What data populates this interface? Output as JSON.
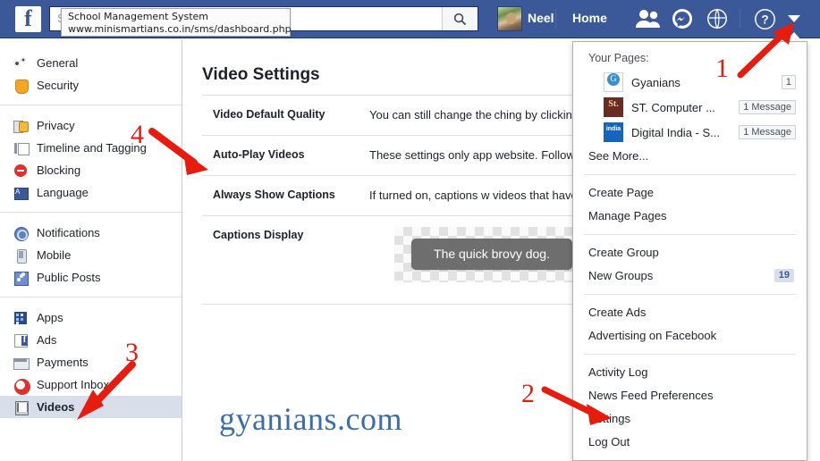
{
  "topbar": {
    "logo_text": "f",
    "search_placeholder": "Search",
    "search_icon": "search-icon",
    "profile_name": "Neel",
    "home_label": "Home",
    "icons": [
      "friend-requests-icon",
      "messenger-icon",
      "notifications-globe-icon",
      "help-icon",
      "account-caret-icon"
    ],
    "background_color": "#3b5998"
  },
  "tooltip": {
    "title": "School Management System",
    "url": "www.minismartians.co.in/sms/dashboard.php"
  },
  "sidebar": {
    "groups": [
      {
        "items": [
          {
            "label": "General",
            "icon": "gears-icon",
            "active": false
          },
          {
            "label": "Security",
            "icon": "shield-icon",
            "active": false
          }
        ]
      },
      {
        "items": [
          {
            "label": "Privacy",
            "icon": "lock-icon",
            "active": false
          },
          {
            "label": "Timeline and Tagging",
            "icon": "timeline-icon",
            "active": false
          },
          {
            "label": "Blocking",
            "icon": "block-icon",
            "active": false
          },
          {
            "label": "Language",
            "icon": "language-icon",
            "active": false
          }
        ]
      },
      {
        "items": [
          {
            "label": "Notifications",
            "icon": "globe-icon",
            "active": false
          },
          {
            "label": "Mobile",
            "icon": "mobile-icon",
            "active": false
          },
          {
            "label": "Public Posts",
            "icon": "rss-icon",
            "active": false
          }
        ]
      },
      {
        "items": [
          {
            "label": "Apps",
            "icon": "apps-icon",
            "active": false
          },
          {
            "label": "Ads",
            "icon": "ads-icon",
            "active": false
          },
          {
            "label": "Payments",
            "icon": "payments-icon",
            "active": false
          },
          {
            "label": "Support Inbox",
            "icon": "support-icon",
            "active": false
          },
          {
            "label": "Videos",
            "icon": "film-icon",
            "active": true
          }
        ]
      }
    ],
    "active_highlight_color": "#d8dfea"
  },
  "main": {
    "page_title": "Video Settings",
    "rows": [
      {
        "label": "Video Default Quality",
        "description": "You can still change the ching by clicking player."
      },
      {
        "label": "Auto-Play Videos",
        "description": "These settings only app website. Follow auto-play videos in you"
      },
      {
        "label": "Always Show Captions",
        "description": "If turned on, captions w videos that have"
      },
      {
        "label": "Captions Display",
        "description": ""
      }
    ],
    "caption_preview_text": "The quick brovy dog.",
    "watermark": "gyanians.com"
  },
  "dropdown": {
    "pages_header": "Your Pages:",
    "pages": [
      {
        "name": "Gyanians",
        "badge": "1",
        "thumb": "gyanians-page-thumb"
      },
      {
        "name": "ST. Computer ...",
        "badge": "1 Message",
        "thumb": "st-computer-page-thumb"
      },
      {
        "name": "Digital India - S...",
        "badge": "1 Message",
        "thumb": "digital-india-page-thumb"
      }
    ],
    "see_more": "See More...",
    "sections": [
      {
        "items": [
          {
            "label": "Create Page",
            "count": ""
          },
          {
            "label": "Manage Pages",
            "count": ""
          }
        ]
      },
      {
        "items": [
          {
            "label": "Create Group",
            "count": ""
          },
          {
            "label": "New Groups",
            "count": "19"
          }
        ]
      },
      {
        "items": [
          {
            "label": "Create Ads",
            "count": ""
          },
          {
            "label": "Advertising on Facebook",
            "count": ""
          }
        ]
      },
      {
        "items": [
          {
            "label": "Activity Log",
            "count": ""
          },
          {
            "label": "News Feed Preferences",
            "count": ""
          },
          {
            "label": "Settings",
            "count": ""
          },
          {
            "label": "Log Out",
            "count": ""
          }
        ]
      }
    ]
  },
  "annotations": {
    "color": "#e81c0e",
    "markers": [
      {
        "number": "1",
        "target": "account-caret-icon"
      },
      {
        "number": "2",
        "target": "dropdown-item-settings"
      },
      {
        "number": "3",
        "target": "sidebar-item-videos"
      },
      {
        "number": "4",
        "target": "settings-row-auto-play-videos"
      }
    ]
  }
}
